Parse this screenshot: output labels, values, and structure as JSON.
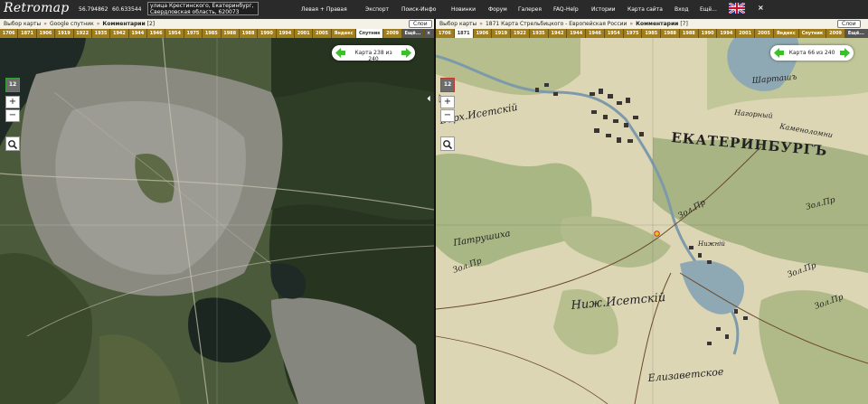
{
  "topbar": {
    "logo": "Retromap",
    "lat": "56.794862",
    "lon": "60.633544",
    "address_line1": "улица Крестинского, Екатеринбург,",
    "address_line2": "Свердловская область, 620073",
    "menu": [
      "Левая + Правая",
      "Экспорт",
      "Поиск-Инфо",
      "Новинки",
      "Форум",
      "Галерея",
      "FAQ-Help",
      "Истории",
      "Карта сайта",
      "Вход",
      "Ещё..."
    ],
    "close": "×"
  },
  "left_pane": {
    "crumb_root": "Выбор карты",
    "crumb_map": "Google спутник",
    "crumb_comments": "Комментарии",
    "comments_count": "[2]",
    "layers_label": "Слои",
    "years": [
      "1706",
      "1871",
      "1906",
      "1919",
      "1922",
      "1935",
      "1942",
      "1944",
      "1946",
      "1954",
      "1975",
      "1985",
      "1988",
      "1988",
      "1990",
      "1994",
      "2001",
      "2005",
      "Яндекс",
      "Спутник",
      "2009",
      "Ещё...",
      "×"
    ],
    "selected_year_index": 19,
    "counter_text": "Карта 238 из 240",
    "zoom": "12",
    "zoom_in": "+",
    "zoom_out": "−"
  },
  "right_pane": {
    "crumb_root": "Выбор карты",
    "crumb_map": "1871 Карта Стрельбицкого - Европейская России",
    "crumb_comments": "Комментарии",
    "comments_count": "[7]",
    "layers_label": "Слои",
    "years": [
      "1706",
      "1871",
      "1906",
      "1919",
      "1922",
      "1935",
      "1942",
      "1944",
      "1946",
      "1954",
      "1975",
      "1985",
      "1988",
      "1988",
      "1990",
      "1994",
      "2001",
      "2005",
      "Яндекс",
      "Спутник",
      "2009",
      "Ещё..."
    ],
    "selected_year_index": 1,
    "counter_text": "Карта 66 из 240",
    "zoom": "12",
    "zoom_in": "+",
    "zoom_out": "−",
    "labels": [
      "ЕКАТЕРИНБУРГЪ",
      "Нагорный",
      "Каменоломни",
      "Зол.Пр",
      "Зол.Пр",
      "Патрушиха",
      "Зол.Пр",
      "Ниж.Исетскiй",
      "Елизаветское",
      "Шарташъ",
      "Зол.Пр",
      "Зол.Пр",
      "Нижнiй",
      "Верх.Исетскiй"
    ]
  },
  "colors": {
    "topbar": "#2a2a2a",
    "year_strip": "#a07e1e",
    "counter_arrow": "#3bbf2a"
  }
}
